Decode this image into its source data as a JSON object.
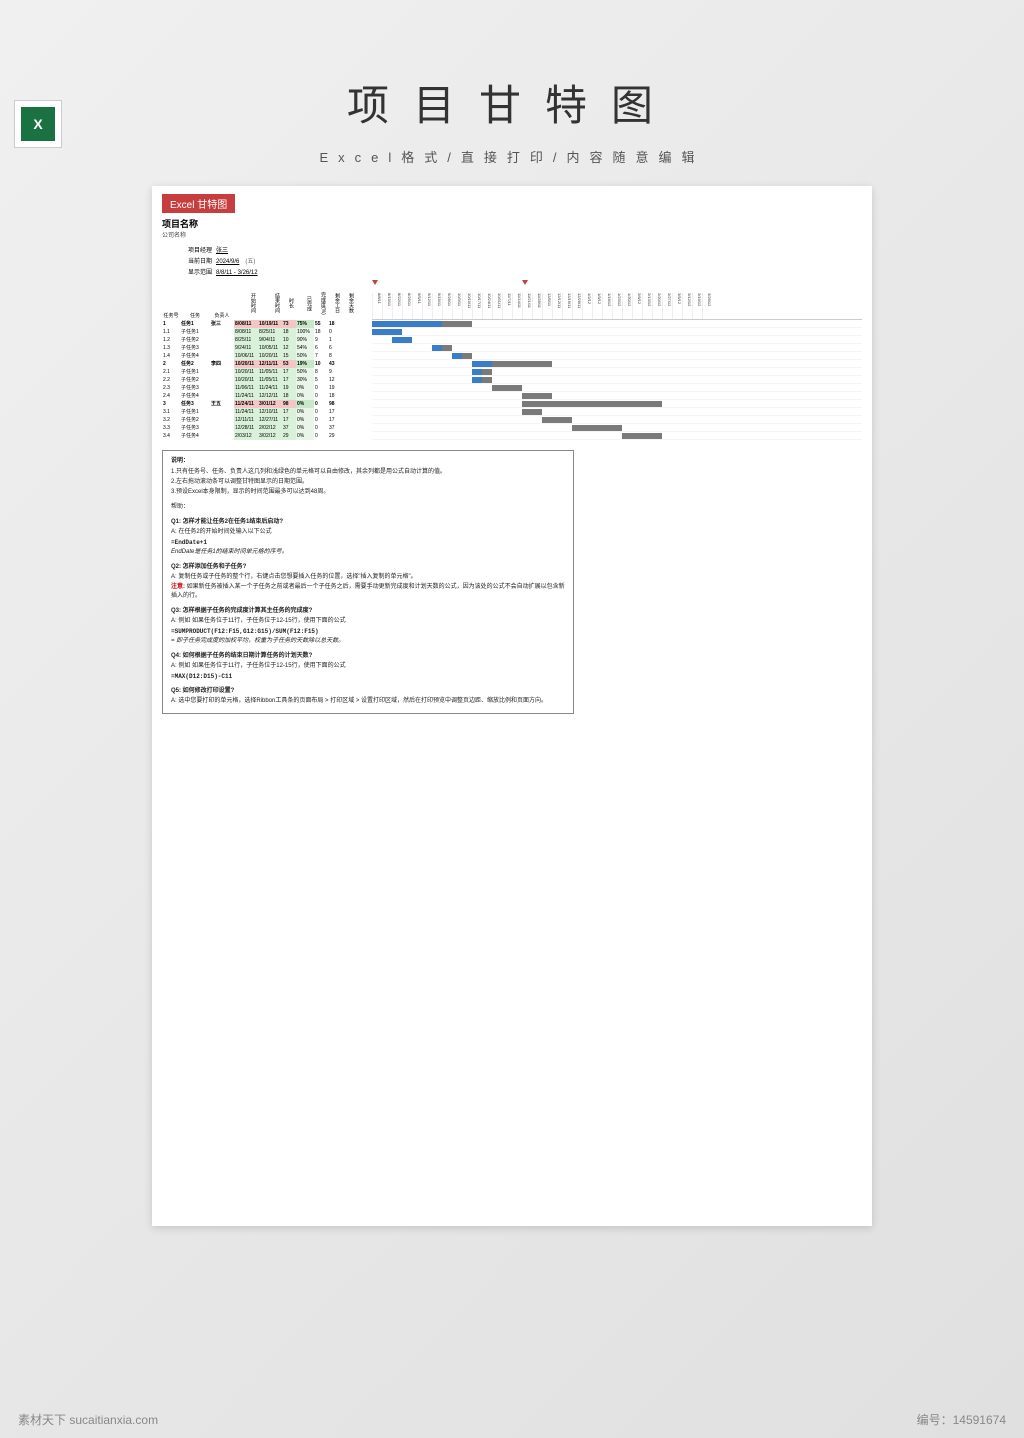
{
  "header": {
    "title": "项目甘特图",
    "subtitle": "Excel格式/直接打印/内容随意编辑"
  },
  "sheet": {
    "badge": "Excel 甘特图",
    "project_title": "项目名称",
    "company": "公司名称",
    "meta": {
      "manager_label": "项目经理",
      "manager": "张三",
      "date_label": "当前日期",
      "date": "2024/9/6",
      "date_extra": "(五)",
      "range_label": "显示范围",
      "range": "8/8/11 - 3/26/12"
    },
    "columns": [
      "任务号",
      "任务",
      "负责人",
      "开始时间",
      "结束时间",
      "时长",
      "已完成",
      "完成度(%)",
      "剩余工日",
      "剩余天数"
    ],
    "timeline_dates": [
      "8/8/11",
      "8/15/11",
      "8/22/11",
      "8/29/11",
      "9/5/11",
      "9/12/11",
      "9/19/11",
      "9/26/11",
      "10/3/11",
      "10/10/11",
      "10/17/11",
      "10/24/11",
      "10/31/11",
      "11/7/11",
      "11/14/11",
      "11/21/11",
      "11/28/11",
      "12/5/11",
      "12/12/11",
      "12/19/11",
      "12/26/11",
      "1/2/12",
      "1/9/12",
      "1/16/12",
      "1/23/12",
      "1/30/12",
      "2/6/12",
      "2/13/12",
      "2/20/12",
      "2/27/12",
      "3/5/12",
      "3/12/12",
      "3/19/12",
      "3/26/12"
    ],
    "rows": [
      {
        "type": "main",
        "num": "1",
        "task": "任务1",
        "owner": "张三",
        "start": "8/08/11",
        "end": "10/19/11",
        "dur": "73",
        "pct": "75%",
        "wd": "55",
        "cd": "18",
        "bar_start": 0,
        "bar_len": 10,
        "done_len": 7
      },
      {
        "type": "sub",
        "num": "1.1",
        "task": "子任务1",
        "owner": "",
        "start": "8/08/11",
        "end": "8/25/11",
        "dur": "18",
        "pct": "100%",
        "wd": "18",
        "cd": "0",
        "bar_start": 0,
        "bar_len": 3,
        "done_len": 3
      },
      {
        "type": "sub",
        "num": "1.2",
        "task": "子任务2",
        "owner": "",
        "start": "8/25/11",
        "end": "9/04/11",
        "dur": "10",
        "pct": "90%",
        "wd": "9",
        "cd": "1",
        "bar_start": 2,
        "bar_len": 2,
        "done_len": 2
      },
      {
        "type": "sub",
        "num": "1.3",
        "task": "子任务3",
        "owner": "",
        "start": "9/24/11",
        "end": "10/05/11",
        "dur": "12",
        "pct": "54%",
        "wd": "6",
        "cd": "6",
        "bar_start": 6,
        "bar_len": 2,
        "done_len": 1
      },
      {
        "type": "sub",
        "num": "1.4",
        "task": "子任务4",
        "owner": "",
        "start": "10/06/11",
        "end": "10/20/11",
        "dur": "15",
        "pct": "50%",
        "wd": "7",
        "cd": "8",
        "bar_start": 8,
        "bar_len": 2,
        "done_len": 1
      },
      {
        "type": "main",
        "num": "2",
        "task": "任务2",
        "owner": "李四",
        "start": "10/20/11",
        "end": "12/11/11",
        "dur": "53",
        "pct": "19%",
        "wd": "10",
        "cd": "43",
        "bar_start": 10,
        "bar_len": 8,
        "done_len": 2
      },
      {
        "type": "sub",
        "num": "2.1",
        "task": "子任务1",
        "owner": "",
        "start": "10/20/11",
        "end": "11/05/11",
        "dur": "17",
        "pct": "50%",
        "wd": "8",
        "cd": "9",
        "bar_start": 10,
        "bar_len": 2,
        "done_len": 1
      },
      {
        "type": "sub",
        "num": "2.2",
        "task": "子任务2",
        "owner": "",
        "start": "10/20/11",
        "end": "11/05/11",
        "dur": "17",
        "pct": "30%",
        "wd": "5",
        "cd": "12",
        "bar_start": 10,
        "bar_len": 2,
        "done_len": 1
      },
      {
        "type": "sub",
        "num": "2.3",
        "task": "子任务3",
        "owner": "",
        "start": "11/06/11",
        "end": "11/24/11",
        "dur": "19",
        "pct": "0%",
        "wd": "0",
        "cd": "19",
        "bar_start": 12,
        "bar_len": 3,
        "done_len": 0
      },
      {
        "type": "sub",
        "num": "2.4",
        "task": "子任务4",
        "owner": "",
        "start": "11/24/11",
        "end": "12/12/11",
        "dur": "18",
        "pct": "0%",
        "wd": "0",
        "cd": "18",
        "bar_start": 15,
        "bar_len": 3,
        "done_len": 0
      },
      {
        "type": "main",
        "num": "3",
        "task": "任务3",
        "owner": "王五",
        "start": "11/24/11",
        "end": "3/01/12",
        "dur": "98",
        "pct": "0%",
        "wd": "0",
        "cd": "98",
        "bar_start": 15,
        "bar_len": 14,
        "done_len": 0
      },
      {
        "type": "sub",
        "num": "3.1",
        "task": "子任务1",
        "owner": "",
        "start": "11/24/11",
        "end": "12/10/11",
        "dur": "17",
        "pct": "0%",
        "wd": "0",
        "cd": "17",
        "bar_start": 15,
        "bar_len": 2,
        "done_len": 0
      },
      {
        "type": "sub",
        "num": "3.2",
        "task": "子任务2",
        "owner": "",
        "start": "12/11/11",
        "end": "12/27/11",
        "dur": "17",
        "pct": "0%",
        "wd": "0",
        "cd": "17",
        "bar_start": 17,
        "bar_len": 3,
        "done_len": 0
      },
      {
        "type": "sub",
        "num": "3.3",
        "task": "子任务3",
        "owner": "",
        "start": "12/28/11",
        "end": "2/02/12",
        "dur": "37",
        "pct": "0%",
        "wd": "0",
        "cd": "37",
        "bar_start": 20,
        "bar_len": 5,
        "done_len": 0
      },
      {
        "type": "sub",
        "num": "3.4",
        "task": "子任务4",
        "owner": "",
        "start": "2/03/12",
        "end": "3/02/12",
        "dur": "29",
        "pct": "0%",
        "wd": "0",
        "cd": "29",
        "bar_start": 25,
        "bar_len": 4,
        "done_len": 0
      }
    ],
    "notes": {
      "title": "说明：",
      "intro": [
        "1.只有任务号、任务、负责人这几列和浅绿色的单元格可以自由修改，其余列都是用公式自动计算的值。",
        "2.左右拖动滚动条可以调整甘特图显示的日期范围。",
        "3.预设Excel本身限制，显示的时间范围最多可以达到48周。"
      ],
      "help_label": "帮助：",
      "qa": [
        {
          "q": "Q1: 怎样才能让任务2在任务1结束后启动?",
          "a": "A: 在任务2的开始时间处输入以下公式",
          "f": "=EndDate+1",
          "n": "EndDate是任务1的结束时间单元格的序号。"
        },
        {
          "q": "Q2: 怎样添加任务和子任务?",
          "a": "A: 复制任务或子任务的整个行，右键点击您想要插入任务的位置，选择\"插入复制的单元格\"。",
          "warn": "注意",
          "warn_text": "如果新任务被插入某一个子任务之前或者最后一个子任务之后，需要手动更新完成度和计划天数的公式，因为该处的公式不会自动扩展以包含新插入的行。"
        },
        {
          "q": "Q3: 怎样根据子任务的完成度计算其主任务的完成度?",
          "a": "A: 例如 如果任务位于11行，子任务位于12-15行，使用下面的公式",
          "f": "=SUMPRODUCT(F12:F15,G12:G15)/SUM(F12:F15)",
          "n": "= 即子任务完成度的加权平均，权重为子任务的天数除以总天数。"
        },
        {
          "q": "Q4: 如何根据子任务的结束日期计算任务的计划天数?",
          "a": "A: 例如 如果任务位于11行，子任务位于12-15行，使用下面的公式",
          "f": "=MAX(D12:D15)-C11"
        },
        {
          "q": "Q5: 如何修改打印设置?",
          "a": "A: 选中您要打印的单元格，选择Ribbon工具条的页面布局 > 打印区域 > 设置打印区域，然后在打印预览中调整页边距、缩放比例和页面方向。"
        }
      ]
    }
  },
  "footer": {
    "left_label": "素材天下",
    "left_url": "sucaitianxia.com",
    "right_label": "编号：",
    "right_value": "14591674"
  }
}
